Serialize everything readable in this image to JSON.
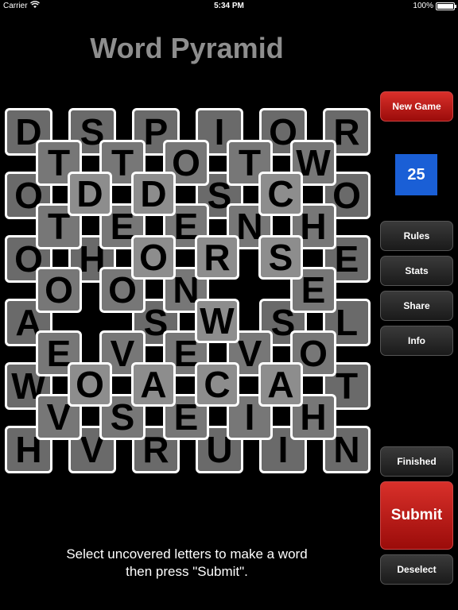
{
  "status_bar": {
    "carrier": "Carrier",
    "time": "5:34 PM",
    "battery": "100%"
  },
  "title": "Word Pyramid",
  "board": {
    "layer0": [
      [
        "D",
        "S",
        "P",
        "I",
        "O",
        "R"
      ],
      [
        "O",
        "",
        "",
        "S",
        "",
        "O"
      ],
      [
        "O",
        "H",
        "",
        "",
        "",
        "E"
      ],
      [
        "A",
        "",
        "S",
        "",
        "S",
        "L"
      ],
      [
        "W",
        "",
        "",
        "",
        "",
        "T"
      ],
      [
        "H",
        "V",
        "R",
        "U",
        "I",
        "N"
      ]
    ],
    "layer1": [
      [
        "T",
        "T",
        "O",
        "T",
        "W"
      ],
      [
        "T",
        "E",
        "E",
        "N",
        "H"
      ],
      [
        "O",
        "O",
        "N",
        "",
        "E"
      ],
      [
        "E",
        "V",
        "E",
        "V",
        "O"
      ],
      [
        "V",
        "S",
        "E",
        "I",
        "H"
      ]
    ],
    "layer2": [
      [
        "D",
        "D",
        "",
        "C"
      ],
      [
        "",
        "O",
        "R",
        "S"
      ],
      [
        "",
        "",
        "W",
        ""
      ],
      [
        "O",
        "A",
        "C",
        "A"
      ]
    ]
  },
  "buttons": {
    "new_game": "New Game",
    "rules": "Rules",
    "stats": "Stats",
    "share": "Share",
    "info": "Info",
    "finished": "Finished",
    "submit": "Submit",
    "deselect": "Deselect"
  },
  "counter": "25",
  "instructions": [
    "Select uncovered letters to make a word",
    "then press \"Submit\"."
  ]
}
